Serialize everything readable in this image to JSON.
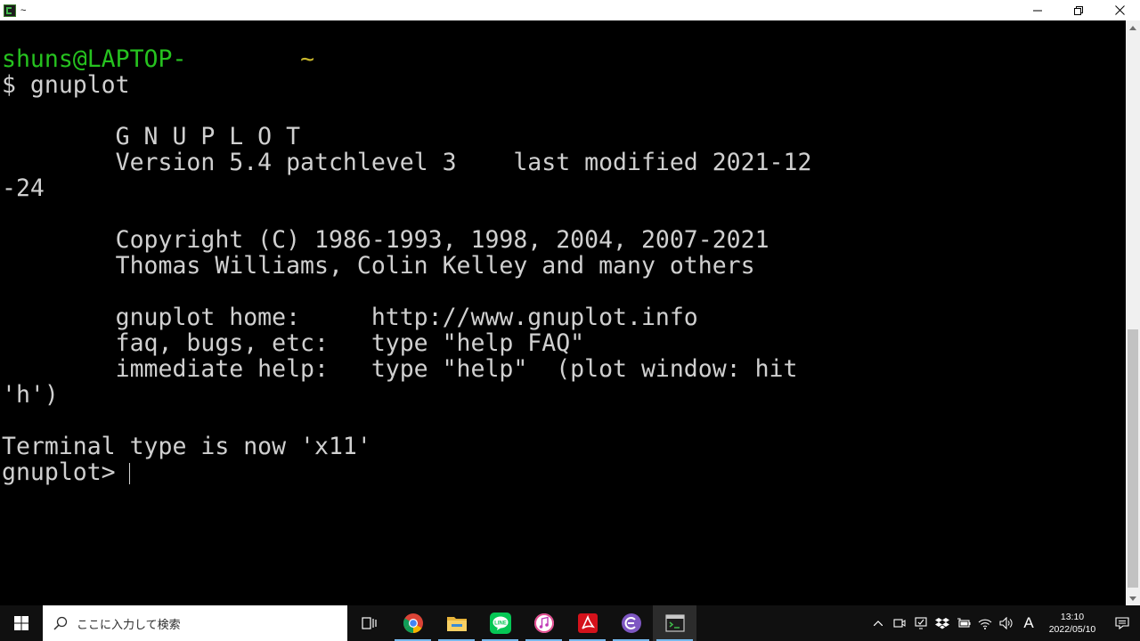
{
  "window": {
    "title": "~",
    "controls": {
      "minimize": "─",
      "maximize": "restore",
      "close": "✕"
    }
  },
  "terminal": {
    "prompt_user": "shuns@LAPTOP-",
    "prompt_path": "~",
    "lines": [
      "$ gnuplot",
      "",
      "        G N U P L O T",
      "        Version 5.4 patchlevel 3    last modified 2021-12",
      "-24",
      "",
      "        Copyright (C) 1986-1993, 1998, 2004, 2007-2021",
      "        Thomas Williams, Colin Kelley and many others",
      "",
      "        gnuplot home:     http://www.gnuplot.info",
      "        faq, bugs, etc:   type \"help FAQ\"",
      "        immediate help:   type \"help\"  (plot window: hit",
      "'h')",
      "",
      "Terminal type is now 'x11'",
      "gnuplot> "
    ]
  },
  "taskbar": {
    "search_placeholder": "ここに入力して検索",
    "apps": [
      {
        "name": "task-view-icon"
      },
      {
        "name": "chrome-icon"
      },
      {
        "name": "file-explorer-icon"
      },
      {
        "name": "line-icon"
      },
      {
        "name": "itunes-icon"
      },
      {
        "name": "acrobat-icon"
      },
      {
        "name": "eclipse-icon"
      },
      {
        "name": "terminal-icon",
        "active": true
      }
    ],
    "tray": {
      "ime": "A",
      "time": "13:10",
      "date": "2022/05/10"
    }
  },
  "colors": {
    "prompt_user": "#26c21f",
    "prompt_path": "#c9b72c",
    "terminal_text": "#d0d0d0",
    "terminal_bg": "#000000",
    "taskbar_bg": "#101010",
    "active_underline": "#76b9ed"
  }
}
